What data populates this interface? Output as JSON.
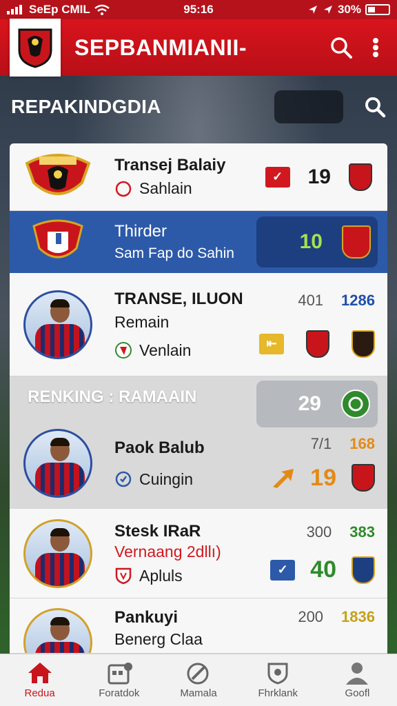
{
  "status": {
    "carrier": "SeEp CMIL",
    "time": "95:16",
    "battery": "30%"
  },
  "appbar": {
    "title": "SEPBANMIANII-"
  },
  "section": {
    "title": "REPAKINDGDIA"
  },
  "rows": [
    {
      "name": "Transej Balaiy",
      "sub": "Sahlain",
      "stat": "19"
    },
    {
      "name": "Thirder",
      "sub": "Sam Fap do Sahin",
      "stat": "10"
    },
    {
      "name": "TRANSE, ILUON",
      "sub": "Remain",
      "sub2": "Venlain",
      "stat_a": "401",
      "stat_b": "1286"
    },
    {
      "banner": "RENKING : RAMAAIN",
      "rank": "29",
      "name": "Paok Balub",
      "sub": "Cuingin",
      "stat_a": "7/1",
      "stat_b": "168",
      "stat_c": "19"
    },
    {
      "name": "Stesk IRaR",
      "sub": "Vernaang 2dllı)",
      "sub2": "Apluls",
      "stat_a": "300",
      "stat_b": "383",
      "stat_c": "40"
    },
    {
      "name": "Pankuyi",
      "sub": "Benerg Claa",
      "stat_a": "200",
      "stat_b": "1836"
    }
  ],
  "nav": [
    {
      "label": "Redua",
      "icon": "home-icon",
      "active": true
    },
    {
      "label": "Foratdok",
      "icon": "calendar-icon"
    },
    {
      "label": "Mamala",
      "icon": "edit-icon"
    },
    {
      "label": "Fhrklank",
      "icon": "shield-icon"
    },
    {
      "label": "Goofl",
      "icon": "user-icon"
    }
  ],
  "colors": {
    "brand_red": "#c8151c",
    "blue": "#2d5aa8",
    "green": "#2f8a2c",
    "orange": "#e38a16"
  }
}
